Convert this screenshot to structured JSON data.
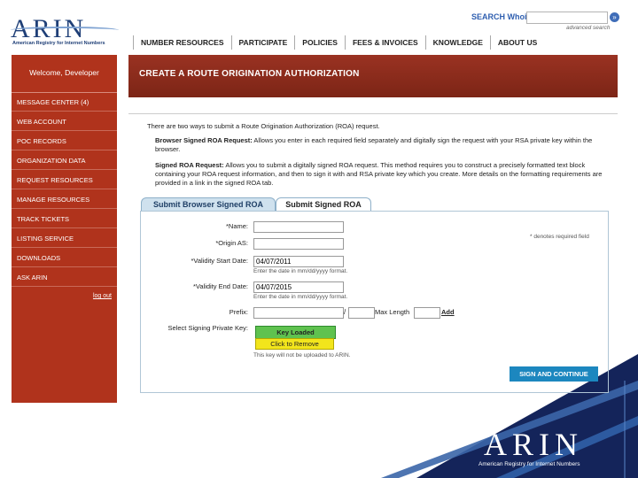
{
  "header": {
    "logo_text": "ARIN",
    "logo_subtitle": "American Registry for Internet Numbers",
    "search_label": "SEARCH Whois",
    "search_value": "",
    "search_go_glyph": "»",
    "advanced_search": "advanced search",
    "nav": [
      "NUMBER RESOURCES",
      "PARTICIPATE",
      "POLICIES",
      "FEES & INVOICES",
      "KNOWLEDGE",
      "ABOUT US"
    ]
  },
  "sidebar": {
    "welcome": "Welcome, Developer",
    "items": [
      "MESSAGE CENTER (4)",
      "WEB ACCOUNT",
      "POC RECORDS",
      "ORGANIZATION DATA",
      "REQUEST RESOURCES",
      "MANAGE RESOURCES",
      "TRACK TICKETS",
      "LISTING SERVICE",
      "DOWNLOADS",
      "ASK ARIN"
    ],
    "logout": "log out"
  },
  "main": {
    "title": "CREATE A ROUTE ORIGINATION AUTHORIZATION",
    "intro": "There are two ways to submit a Route Origination Authorization (ROA) request.",
    "browser_lead": "Browser Signed ROA Request:",
    "browser_text": "Allows you enter in each required field separately and digitally sign the request with your RSA private key within the browser.",
    "signed_lead": "Signed ROA Request:",
    "signed_text": "Allows you to submit a digitally signed ROA request. This method requires you to construct a precisely formatted text block containing your ROA request information, and then to sign it with and RSA private key which you create. More details on the formatting requirements are provided in a link in the signed ROA tab.",
    "tabs": [
      "Submit Browser Signed ROA",
      "Submit Signed ROA"
    ],
    "required_note": "* denotes required field",
    "form": {
      "name_label": "*Name:",
      "name_value": "",
      "origin_label": "*Origin AS:",
      "origin_value": "",
      "start_label": "*Validity Start Date:",
      "start_value": "04/07/2011",
      "start_hint": "Enter the date in mm/dd/yyyy format.",
      "end_label": "*Validity End Date:",
      "end_value": "04/07/2015",
      "end_hint": "Enter the date in mm/dd/yyyy format.",
      "prefix_label": "Prefix:",
      "prefix_value": "",
      "slash": "/",
      "cidr_value": "",
      "maxlength_label": "Max Length",
      "maxlength_value": "",
      "add_link": "Add",
      "key_label": "Select Signing Private Key:",
      "key_loaded": "Key Loaded",
      "click_remove": "Click to Remove",
      "key_note": "This key will not be uploaded to ARIN.",
      "submit": "SIGN AND CONTINUE"
    }
  },
  "footer_logo": {
    "text": "ARIN",
    "subtitle": "American Registry for Internet Numbers"
  },
  "colors": {
    "sidebar": "#b0331c",
    "header_band": "#8c2a1a",
    "tab_active": "#cfe1ee",
    "key_loaded": "#5fc24f",
    "click_remove": "#f2e51c",
    "submit": "#1c87bf",
    "footer_bg": "#14245a"
  }
}
